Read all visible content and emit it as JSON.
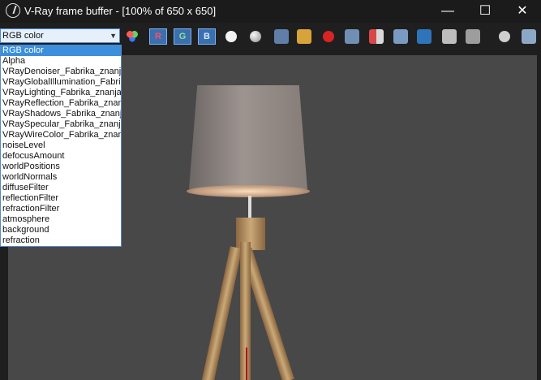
{
  "window": {
    "title": "V-Ray frame buffer - [100% of 650 x 650]",
    "controls": {
      "minimize": "—",
      "maximize": "☐",
      "close": "✕"
    }
  },
  "toolbar": {
    "channel_select": {
      "selected": "RGB color",
      "options": [
        "RGB color",
        "Alpha",
        "VRayDenoiser_Fabrika_znanja",
        "VRayGlobalIllumination_Fabrika",
        "VRayLighting_Fabrika_znanja_",
        "VRayReflection_Fabrika_znanj",
        "VRayShadows_Fabrika_znanja",
        "VRaySpecular_Fabrika_znanja_",
        "VRayWireColor_Fabrika_znanj",
        "noiseLevel",
        "defocusAmount",
        "worldPositions",
        "worldNormals",
        "diffuseFilter",
        "reflectionFilter",
        "refractionFilter",
        "atmosphere",
        "background",
        "refraction"
      ]
    },
    "channels": {
      "r": "R",
      "g": "G",
      "b": "B"
    }
  },
  "colors": {
    "title_bar": "#1b1b1b",
    "toolbar": "#1f1f1f",
    "viewport": "#484848",
    "selected_option": "#3b8fdc"
  }
}
